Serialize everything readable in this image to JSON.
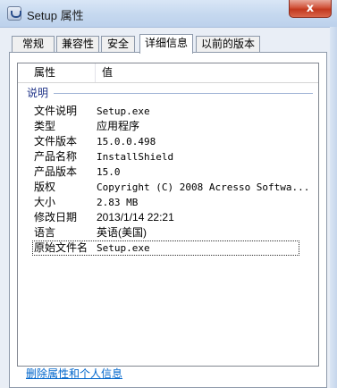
{
  "window": {
    "title": "Setup 属性",
    "close_glyph": "x"
  },
  "tabs": [
    {
      "label": "常规"
    },
    {
      "label": "兼容性"
    },
    {
      "label": "安全"
    },
    {
      "label": "详细信息"
    },
    {
      "label": "以前的版本"
    }
  ],
  "details": {
    "header": {
      "property": "属性",
      "value": "值"
    },
    "group": "说明",
    "rows": [
      {
        "key": "文件说明",
        "value": "Setup.exe"
      },
      {
        "key": "类型",
        "value": "应用程序"
      },
      {
        "key": "文件版本",
        "value": "15.0.0.498"
      },
      {
        "key": "产品名称",
        "value": "InstallShield"
      },
      {
        "key": "产品版本",
        "value": "15.0"
      },
      {
        "key": "版权",
        "value": "Copyright (C) 2008 Acresso Softwa..."
      },
      {
        "key": "大小",
        "value": "2.83 MB"
      },
      {
        "key": "修改日期",
        "value": "2013/1/14 22:21"
      },
      {
        "key": "语言",
        "value": "英语(美国)"
      },
      {
        "key": "原始文件名",
        "value": "Setup.exe"
      }
    ]
  },
  "footer": {
    "remove_link": "删除属性和个人信息"
  }
}
